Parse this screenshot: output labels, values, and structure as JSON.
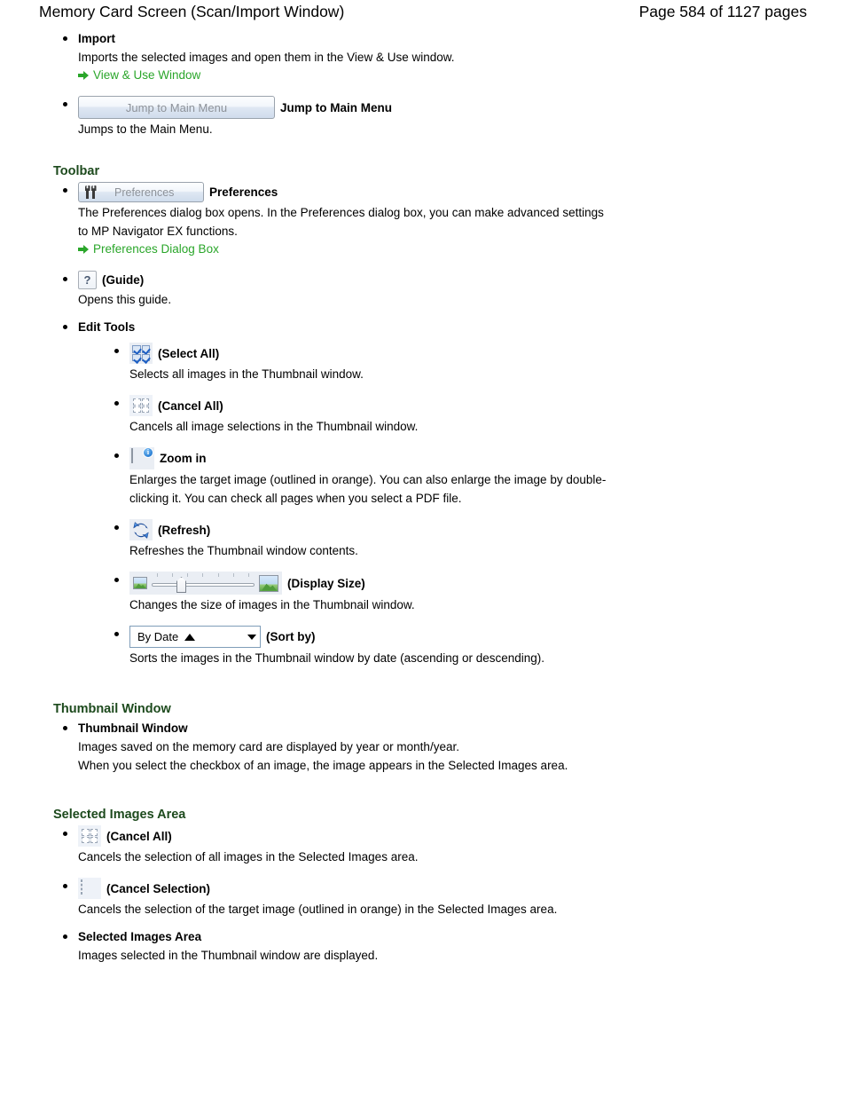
{
  "header": {
    "title": "Memory Card Screen (Scan/Import Window)",
    "page_count": "Page 584 of 1127 pages"
  },
  "colors": {
    "heading_green": "#1d4a1d",
    "link_green": "#2aa62a",
    "text_black": "#000000"
  },
  "intro_items": [
    {
      "title": "Import",
      "desc": "Imports the selected images and open them in the View & Use window.",
      "link": "View & Use Window"
    },
    {
      "button_label": "Jump to Main Menu",
      "caption": "Jump to Main Menu",
      "desc": "Jumps to the Main Menu."
    }
  ],
  "sections": [
    {
      "heading": "Toolbar",
      "items": [
        {
          "icon": "preferences-tools-icon",
          "button_label": "Preferences",
          "caption": "Preferences",
          "desc_line1": "The Preferences dialog box opens. In the Preferences dialog box, you can make advanced settings",
          "desc_line2": "to MP Navigator EX functions.",
          "link": "Preferences Dialog Box"
        },
        {
          "icon": "guide-question-icon",
          "caption": "(Guide)",
          "desc": "Opens this guide."
        },
        {
          "caption": "Edit Tools",
          "subitems": [
            {
              "icon": "select-all-grid-icon",
              "caption": "(Select All)",
              "desc": "Selects all images in the Thumbnail window."
            },
            {
              "icon": "cancel-all-grid-icon",
              "caption": "(Cancel All)",
              "desc": "Cancels all image selections in the Thumbnail window."
            },
            {
              "icon": "zoom-in-picture-icon",
              "caption": "Zoom in",
              "desc_line1": "Enlarges the target image (outlined in orange). You can also enlarge the image by double-",
              "desc_line2": "clicking it. You can check all pages when you select a PDF file."
            },
            {
              "icon": "refresh-icon",
              "caption": "(Refresh)",
              "desc": "Refreshes the Thumbnail window contents."
            },
            {
              "icon": "display-size-slider",
              "caption": "(Display Size)",
              "desc": "Changes the size of images in the Thumbnail window."
            },
            {
              "icon": "sort-by-combobox",
              "combo_value": "By Date",
              "caption": "(Sort by)",
              "desc": "Sorts the images in the Thumbnail window by date (ascending or descending)."
            }
          ]
        }
      ]
    },
    {
      "heading": "Thumbnail Window",
      "items": [
        {
          "caption": "Thumbnail Window",
          "desc_line1": "Images saved on the memory card are displayed by year or month/year.",
          "desc_line2": "When you select the checkbox of an image, the image appears in the Selected Images area."
        }
      ]
    },
    {
      "heading": "Selected Images Area",
      "items": [
        {
          "icon": "cancel-all-grid-icon",
          "caption": "(Cancel All)",
          "desc": "Cancels the selection of all images in the Selected Images area."
        },
        {
          "icon": "cancel-selection-box-icon",
          "caption": "(Cancel Selection)",
          "desc": "Cancels the selection of the target image (outlined in orange) in the Selected Images area."
        },
        {
          "caption": "Selected Images Area",
          "desc": "Images selected in the Thumbnail window are displayed."
        }
      ]
    }
  ]
}
